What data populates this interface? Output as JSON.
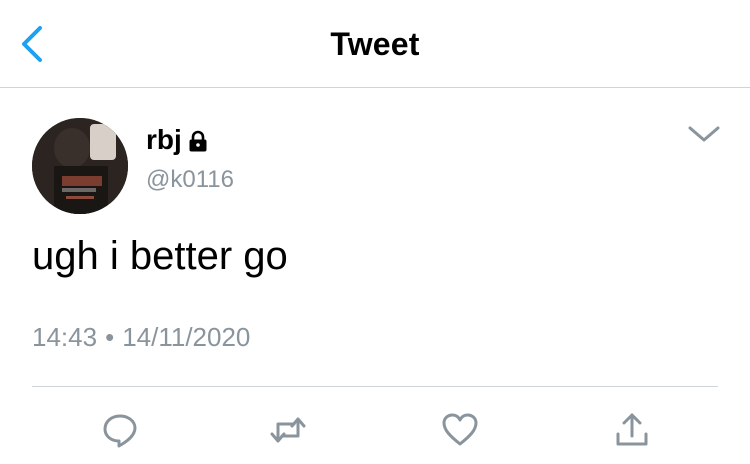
{
  "header": {
    "title": "Tweet",
    "back_icon": "chevron-left-icon",
    "accent_color": "#1da1f2"
  },
  "tweet": {
    "display_name": "rbj",
    "protected_icon": "lock-icon",
    "handle": "@k0116",
    "text": "ugh i better go",
    "time": "14:43",
    "separator": "•",
    "date": "14/11/2020",
    "menu_icon": "chevron-down-icon"
  },
  "actions": [
    {
      "name": "reply",
      "icon": "reply-icon"
    },
    {
      "name": "retweet",
      "icon": "retweet-icon"
    },
    {
      "name": "like",
      "icon": "heart-icon"
    },
    {
      "name": "share",
      "icon": "share-icon"
    }
  ],
  "colors": {
    "secondary_text": "#8a949d",
    "icon_gray": "#8a949d",
    "divider": "#cfd4d8"
  }
}
